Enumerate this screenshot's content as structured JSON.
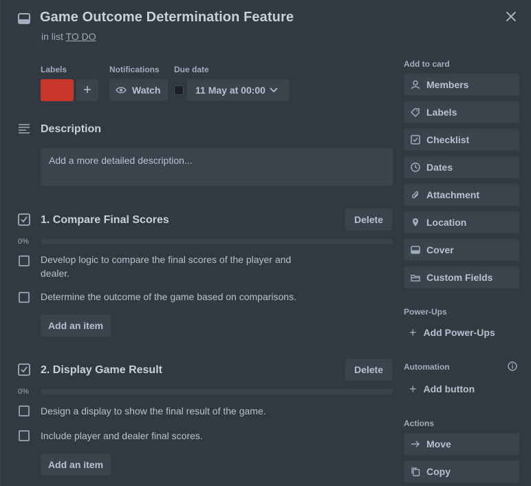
{
  "card": {
    "title": "Game Outcome Determination Feature",
    "in_list_prefix": "in list",
    "list_name": "TO DO"
  },
  "meta": {
    "labels_heading": "Labels",
    "label_color": "#c9372c",
    "notifications_heading": "Notifications",
    "watch_label": "Watch",
    "due_heading": "Due date",
    "due_value": "11 May at 00:00"
  },
  "description": {
    "heading": "Description",
    "placeholder": "Add a more detailed description..."
  },
  "checklists": [
    {
      "title": "1. Compare Final Scores",
      "delete_label": "Delete",
      "progress_label": "0%",
      "progress": 0,
      "items": [
        {
          "text": "Develop logic to compare the final scores of the player and dealer.",
          "checked": false
        },
        {
          "text": "Determine the outcome of the game based on comparisons.",
          "checked": false
        }
      ],
      "add_item_label": "Add an item"
    },
    {
      "title": "2. Display Game Result",
      "delete_label": "Delete",
      "progress_label": "0%",
      "progress": 0,
      "items": [
        {
          "text": "Design a display to show the final result of the game.",
          "checked": false
        },
        {
          "text": "Include player and dealer final scores.",
          "checked": false
        }
      ],
      "add_item_label": "Add an item"
    }
  ],
  "sidebar": {
    "add_to_card_heading": "Add to card",
    "add_to_card": [
      {
        "label": "Members",
        "icon": "person-icon"
      },
      {
        "label": "Labels",
        "icon": "tag-icon"
      },
      {
        "label": "Checklist",
        "icon": "checklist-icon"
      },
      {
        "label": "Dates",
        "icon": "clock-icon"
      },
      {
        "label": "Attachment",
        "icon": "paperclip-icon"
      },
      {
        "label": "Location",
        "icon": "pin-icon"
      },
      {
        "label": "Cover",
        "icon": "cover-icon"
      },
      {
        "label": "Custom Fields",
        "icon": "custom-fields-icon"
      }
    ],
    "powerups_heading": "Power-Ups",
    "add_powerups_label": "Add Power-Ups",
    "automation_heading": "Automation",
    "add_button_label": "Add button",
    "actions_heading": "Actions",
    "actions": [
      {
        "label": "Move",
        "icon": "arrow-right-icon"
      },
      {
        "label": "Copy",
        "icon": "copy-icon"
      }
    ]
  },
  "colors": {
    "background": "#323940",
    "button": "#3b444c",
    "text": "#b6c2cf",
    "accent_label": "#c9372c"
  }
}
